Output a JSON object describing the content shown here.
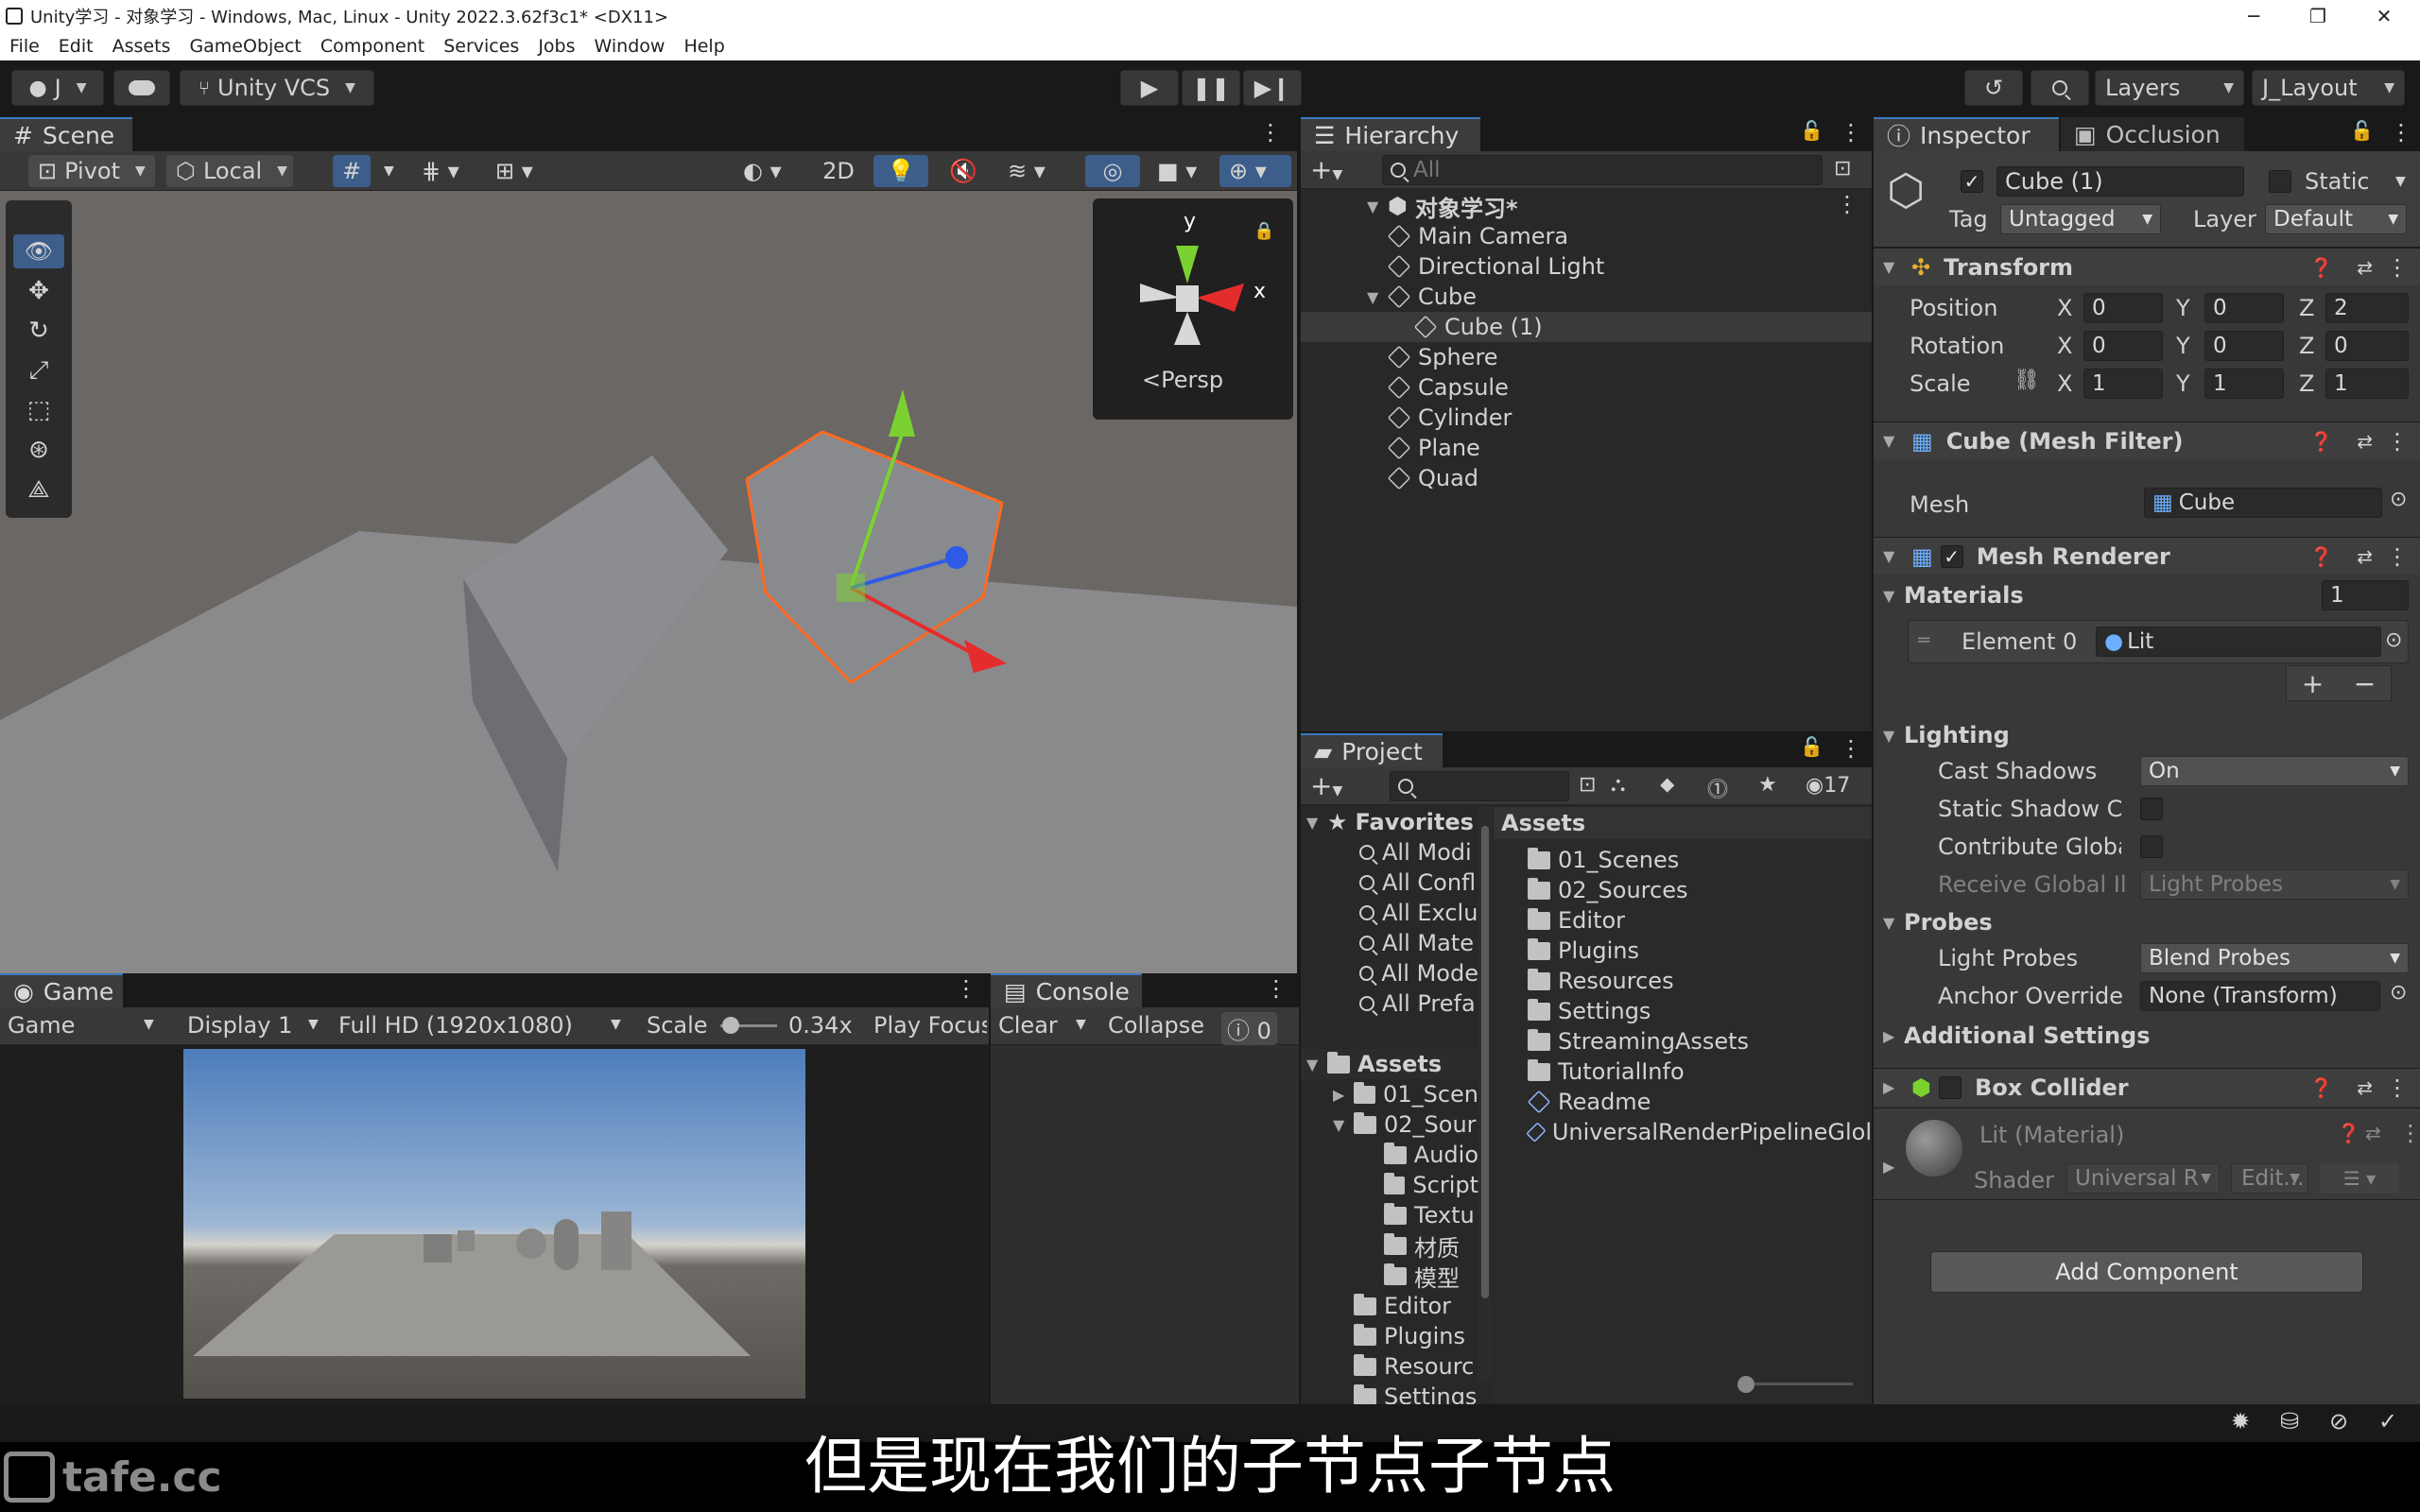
{
  "window": {
    "title": "Unity学习 - 对象学习 - Windows, Mac, Linux - Unity 2022.3.62f3c1* <DX11>",
    "minimize": "─",
    "maximize": "❐",
    "close": "✕"
  },
  "menu": [
    "File",
    "Edit",
    "Assets",
    "GameObject",
    "Component",
    "Services",
    "Jobs",
    "Window",
    "Help"
  ],
  "toolbar": {
    "account": "J",
    "vcs": "Unity VCS",
    "layers": "Layers",
    "layout": "J_Layout"
  },
  "scene": {
    "tab": "Scene",
    "pivot": "Pivot",
    "local": "Local",
    "mode2d": "2D",
    "gizmo": {
      "y": "y",
      "x": "x",
      "persp": "Persp"
    }
  },
  "game": {
    "tab": "Game",
    "mode": "Game",
    "display": "Display 1",
    "resolution": "Full HD (1920x1080)",
    "scale_label": "Scale",
    "scale_value": "0.34x",
    "play_focus": "Play Focus"
  },
  "console": {
    "tab": "Console",
    "clear": "Clear",
    "collapse": "Collapse",
    "count": "0"
  },
  "hierarchy": {
    "tab": "Hierarchy",
    "search_placeholder": "All",
    "scene_name": "对象学习*",
    "items": [
      {
        "label": "Main Camera",
        "depth": 1
      },
      {
        "label": "Directional Light",
        "depth": 1
      },
      {
        "label": "Cube",
        "depth": 1
      },
      {
        "label": "Cube (1)",
        "depth": 2
      },
      {
        "label": "Sphere",
        "depth": 1
      },
      {
        "label": "Capsule",
        "depth": 1
      },
      {
        "label": "Cylinder",
        "depth": 1
      },
      {
        "label": "Plane",
        "depth": 1
      },
      {
        "label": "Quad",
        "depth": 1
      }
    ]
  },
  "project": {
    "tab": "Project",
    "hidden_count": "17",
    "favorites_label": "Favorites",
    "favorites": [
      "All Modi",
      "All Confl",
      "All Exclu",
      "All Mate",
      "All Mode",
      "All Prefa"
    ],
    "assets_label": "Assets",
    "tree": [
      {
        "label": "01_Scen",
        "depth": 1
      },
      {
        "label": "02_Sour",
        "depth": 1
      },
      {
        "label": "Audio",
        "depth": 2
      },
      {
        "label": "Script",
        "depth": 2
      },
      {
        "label": "Textu",
        "depth": 2
      },
      {
        "label": "材质",
        "depth": 2
      },
      {
        "label": "模型",
        "depth": 2
      },
      {
        "label": "Editor",
        "depth": 1
      },
      {
        "label": "Plugins",
        "depth": 1
      },
      {
        "label": "Resourc",
        "depth": 1
      },
      {
        "label": "Settings",
        "depth": 1
      }
    ],
    "breadcrumb": "Assets",
    "contents": [
      {
        "label": "01_Scenes",
        "kind": "folder"
      },
      {
        "label": "02_Sources",
        "kind": "folder"
      },
      {
        "label": "Editor",
        "kind": "folder"
      },
      {
        "label": "Plugins",
        "kind": "folder"
      },
      {
        "label": "Resources",
        "kind": "folder"
      },
      {
        "label": "Settings",
        "kind": "folder"
      },
      {
        "label": "StreamingAssets",
        "kind": "folder"
      },
      {
        "label": "TutorialInfo",
        "kind": "folder"
      },
      {
        "label": "Readme",
        "kind": "asset"
      },
      {
        "label": "UniversalRenderPipelineGlol",
        "kind": "asset"
      }
    ]
  },
  "inspector": {
    "tab": "Inspector",
    "tab2": "Occlusion",
    "object_name": "Cube (1)",
    "static_label": "Static",
    "tag_label": "Tag",
    "tag_value": "Untagged",
    "layer_label": "Layer",
    "layer_value": "Default",
    "transform": {
      "title": "Transform",
      "position_label": "Position",
      "position": {
        "x": "0",
        "y": "0",
        "z": "2"
      },
      "rotation_label": "Rotation",
      "rotation": {
        "x": "0",
        "y": "0",
        "z": "0"
      },
      "scale_label": "Scale",
      "scale": {
        "x": "1",
        "y": "1",
        "z": "1"
      },
      "axis_x": "X",
      "axis_y": "Y",
      "axis_z": "Z"
    },
    "mesh_filter": {
      "title": "Cube (Mesh Filter)",
      "mesh_label": "Mesh",
      "mesh_value": "Cube"
    },
    "mesh_renderer": {
      "title": "Mesh Renderer",
      "materials_label": "Materials",
      "materials_count": "1",
      "element_label": "Element 0",
      "element_value": "Lit",
      "lighting_label": "Lighting",
      "cast_shadows_label": "Cast Shadows",
      "cast_shadows_value": "On",
      "static_shadow_label": "Static Shadow Cas",
      "contribute_gi_label": "Contribute Global I",
      "receive_gi_label": "Receive Global Illu",
      "receive_gi_value": "Light Probes",
      "probes_label": "Probes",
      "light_probes_label": "Light Probes",
      "light_probes_value": "Blend Probes",
      "anchor_label": "Anchor Override",
      "anchor_value": "None (Transform)",
      "additional_label": "Additional Settings"
    },
    "box_collider": {
      "title": "Box Collider"
    },
    "material": {
      "title": "Lit (Material)",
      "shader_label": "Shader",
      "shader_value": "Universal R",
      "edit_label": "Edit..."
    },
    "add_component": "Add Component"
  },
  "subtitle": "但是现在我们的子节点子节点",
  "watermark": "tafe.cc",
  "colors": {
    "accent": "#3a79bb",
    "selection_outline": "#ff6a22",
    "gizmo_y": "#7bd12f",
    "gizmo_x": "#e52c2c",
    "gizmo_z": "#2d5ae6"
  }
}
